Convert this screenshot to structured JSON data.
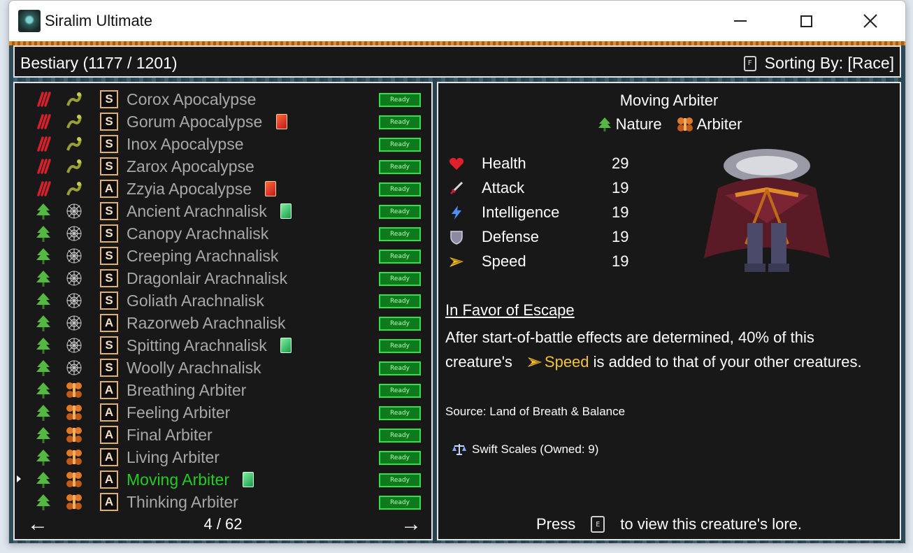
{
  "window": {
    "title": "Siralim Ultimate",
    "icons": {
      "minimize": "minimize-icon",
      "maximize": "maximize-icon",
      "close": "close-icon"
    }
  },
  "header": {
    "title": "Bestiary (1177 / 1201)",
    "sort_key": "F",
    "sort_label": "Sorting By: [Race]"
  },
  "list": {
    "ready_label": "Ready",
    "rows": [
      {
        "element": "chaos",
        "race": "apocalypse",
        "type": "S",
        "name": "Corox Apocalypse",
        "flag": ""
      },
      {
        "element": "chaos",
        "race": "apocalypse",
        "type": "S",
        "name": "Gorum Apocalypse",
        "flag": "red"
      },
      {
        "element": "chaos",
        "race": "apocalypse",
        "type": "S",
        "name": "Inox Apocalypse",
        "flag": ""
      },
      {
        "element": "chaos",
        "race": "apocalypse",
        "type": "S",
        "name": "Zarox Apocalypse",
        "flag": ""
      },
      {
        "element": "chaos",
        "race": "apocalypse",
        "type": "A",
        "name": "Zzyia Apocalypse",
        "flag": "red"
      },
      {
        "element": "nature",
        "race": "arachnalisk",
        "type": "S",
        "name": "Ancient Arachnalisk",
        "flag": "green"
      },
      {
        "element": "nature",
        "race": "arachnalisk",
        "type": "S",
        "name": "Canopy Arachnalisk",
        "flag": ""
      },
      {
        "element": "nature",
        "race": "arachnalisk",
        "type": "S",
        "name": "Creeping Arachnalisk",
        "flag": ""
      },
      {
        "element": "nature",
        "race": "arachnalisk",
        "type": "S",
        "name": "Dragonlair Arachnalisk",
        "flag": ""
      },
      {
        "element": "nature",
        "race": "arachnalisk",
        "type": "S",
        "name": "Goliath Arachnalisk",
        "flag": ""
      },
      {
        "element": "nature",
        "race": "arachnalisk",
        "type": "A",
        "name": "Razorweb Arachnalisk",
        "flag": ""
      },
      {
        "element": "nature",
        "race": "arachnalisk",
        "type": "S",
        "name": "Spitting Arachnalisk",
        "flag": "green"
      },
      {
        "element": "nature",
        "race": "arachnalisk",
        "type": "S",
        "name": "Woolly Arachnalisk",
        "flag": ""
      },
      {
        "element": "nature",
        "race": "arbiter",
        "type": "A",
        "name": "Breathing Arbiter",
        "flag": ""
      },
      {
        "element": "nature",
        "race": "arbiter",
        "type": "A",
        "name": "Feeling Arbiter",
        "flag": ""
      },
      {
        "element": "nature",
        "race": "arbiter",
        "type": "A",
        "name": "Final Arbiter",
        "flag": ""
      },
      {
        "element": "nature",
        "race": "arbiter",
        "type": "A",
        "name": "Living Arbiter",
        "flag": ""
      },
      {
        "element": "nature",
        "race": "arbiter",
        "type": "A",
        "name": "Moving Arbiter",
        "flag": "green",
        "selected": true
      },
      {
        "element": "nature",
        "race": "arbiter",
        "type": "A",
        "name": "Thinking Arbiter",
        "flag": ""
      }
    ],
    "page": "4 / 62",
    "prev_icon": "arrow-left-icon",
    "next_icon": "arrow-right-icon"
  },
  "detail": {
    "name": "Moving Arbiter",
    "element": "Nature",
    "race": "Arbiter",
    "stats": [
      {
        "icon": "heart-icon",
        "label": "Health",
        "value": "29"
      },
      {
        "icon": "sword-icon",
        "label": "Attack",
        "value": "19"
      },
      {
        "icon": "lightning-icon",
        "label": "Intelligence",
        "value": "19"
      },
      {
        "icon": "shield-icon",
        "label": "Defense",
        "value": "19"
      },
      {
        "icon": "wing-icon",
        "label": "Speed",
        "value": "19"
      }
    ],
    "trait_name": "In Favor of Escape",
    "trait_desc_1": "After start-of-battle effects are determined, 40% of this",
    "trait_desc_2a": "creature's",
    "trait_desc_speed": "Speed",
    "trait_desc_2b": "is added to that of your other creatures.",
    "source": "Source: Land of Breath & Balance",
    "item": "Swift Scales (Owned: 9)",
    "footer_press": "Press",
    "footer_key": "E",
    "footer_rest": "to view this creature's lore."
  },
  "colors": {
    "selected": "#22cc22",
    "ready_bg": "#0d7a1c",
    "speed_highlight": "#f2c230",
    "panel_bg": "#181818"
  }
}
